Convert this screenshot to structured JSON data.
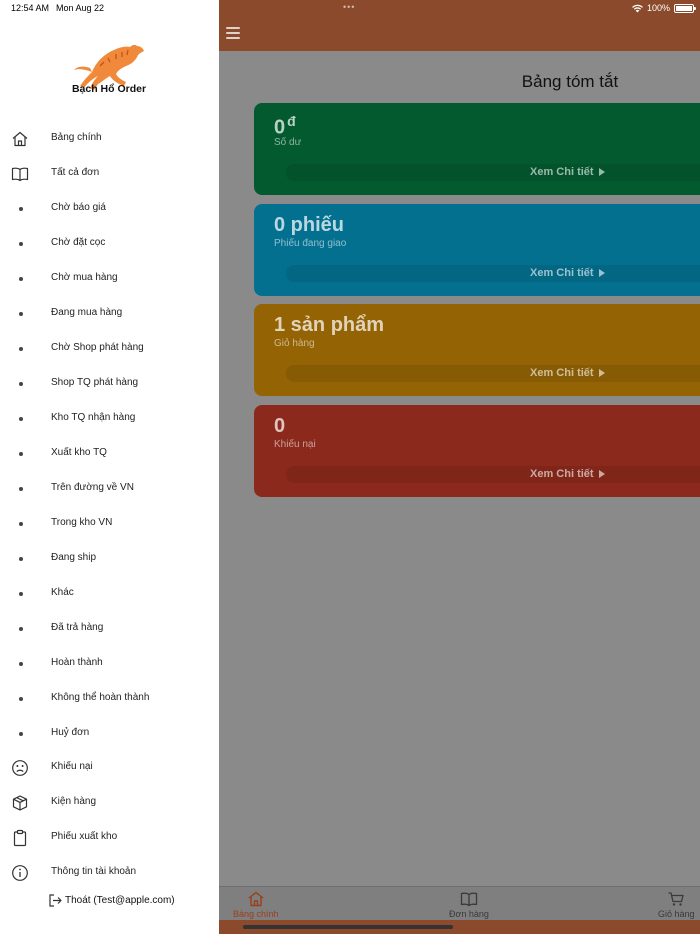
{
  "status": {
    "time": "12:54 AM",
    "date": "Mon Aug 22",
    "battery": "100%"
  },
  "app": {
    "name": "Bạch Hổ Order",
    "page_title": "Bảng tóm tắt"
  },
  "cards": [
    {
      "value": "0",
      "unit": "đ",
      "label": "Số dư",
      "detail": "Xem Chi tiết"
    },
    {
      "value": "0 phiếu",
      "unit": "",
      "label": "Phiếu đang giao",
      "detail": "Xem Chi tiết"
    },
    {
      "value": "1 sản phẩm",
      "unit": "",
      "label": "Giỏ hàng",
      "detail": "Xem Chi tiết"
    },
    {
      "value": "0",
      "unit": "",
      "label": "Khiếu nại",
      "detail": "Xem Chi tiết"
    }
  ],
  "menu": [
    {
      "label": "Bảng chính",
      "icon": "home-icon"
    },
    {
      "label": "Tất cả đơn",
      "icon": "book-icon"
    },
    {
      "label": "Chờ báo giá",
      "icon": "bullet"
    },
    {
      "label": "Chờ đặt cọc",
      "icon": "bullet"
    },
    {
      "label": "Chờ mua hàng",
      "icon": "bullet"
    },
    {
      "label": "Đang mua hàng",
      "icon": "bullet"
    },
    {
      "label": "Chờ Shop phát hàng",
      "icon": "bullet"
    },
    {
      "label": "Shop TQ phát hàng",
      "icon": "bullet"
    },
    {
      "label": "Kho TQ nhận hàng",
      "icon": "bullet"
    },
    {
      "label": "Xuất kho TQ",
      "icon": "bullet"
    },
    {
      "label": "Trên đường về VN",
      "icon": "bullet"
    },
    {
      "label": "Trong kho VN",
      "icon": "bullet"
    },
    {
      "label": "Đang ship",
      "icon": "bullet"
    },
    {
      "label": "Khác",
      "icon": "bullet"
    },
    {
      "label": "Đã trả hàng",
      "icon": "bullet"
    },
    {
      "label": "Hoàn thành",
      "icon": "bullet"
    },
    {
      "label": "Không thể hoàn thành",
      "icon": "bullet"
    },
    {
      "label": "Huỷ đơn",
      "icon": "bullet"
    },
    {
      "label": "Khiếu nại",
      "icon": "sad-face-icon"
    },
    {
      "label": "Kiện hàng",
      "icon": "package-icon"
    },
    {
      "label": "Phiếu xuất kho",
      "icon": "clipboard-icon"
    },
    {
      "label": "Thông tin tài khoản",
      "icon": "info-icon"
    }
  ],
  "logout": {
    "label": "Thoát (Test@apple.com)",
    "icon": "logout-icon"
  },
  "tabs": [
    {
      "label": "Bảng chính",
      "icon": "home-icon",
      "active": true
    },
    {
      "label": "Đơn hàng",
      "icon": "book-icon",
      "active": false
    },
    {
      "label": "Giỏ hàng",
      "icon": "cart-icon",
      "active": false
    }
  ],
  "colors": {
    "brand": "#c95a2e",
    "card_balance": "#035a2f",
    "card_delivering": "#04708f",
    "card_cart": "#936304",
    "card_complaint": "#8b2a1c"
  }
}
